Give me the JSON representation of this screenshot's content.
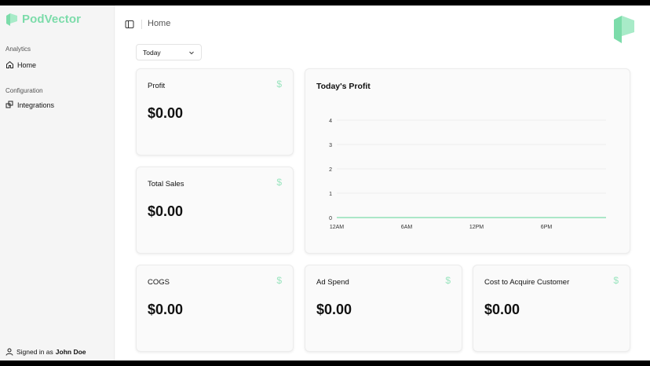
{
  "app": {
    "name": "PodVector",
    "accent": "#7cdcaa"
  },
  "sidebar": {
    "sections": [
      {
        "label": "Analytics",
        "items": [
          {
            "label": "Home",
            "icon": "home-icon"
          }
        ]
      },
      {
        "label": "Configuration",
        "items": [
          {
            "label": "Integrations",
            "icon": "puzzle-icon"
          }
        ]
      }
    ],
    "footer": {
      "prefix": "Signed in as",
      "user": "John Doe"
    }
  },
  "header": {
    "title": "Home"
  },
  "filter": {
    "selected": "Today"
  },
  "cards": {
    "profit": {
      "title": "Profit",
      "value": "$0.00",
      "icon": "$"
    },
    "total_sales": {
      "title": "Total Sales",
      "value": "$0.00",
      "icon": "$"
    },
    "cogs": {
      "title": "COGS",
      "value": "$0.00",
      "icon": "$"
    },
    "ad_spend": {
      "title": "Ad Spend",
      "value": "$0.00",
      "icon": "$"
    },
    "cac": {
      "title": "Cost to Acquire Customer",
      "value": "$0.00",
      "icon": "$"
    }
  },
  "chart_data": {
    "type": "line",
    "title": "Today's Profit",
    "x_tick_labels": [
      "12AM",
      "6AM",
      "12PM",
      "6PM"
    ],
    "y_tick_labels": [
      "0",
      "1",
      "2",
      "3",
      "4"
    ],
    "ylim": [
      0,
      4
    ],
    "grid": true,
    "series": [
      {
        "color": "#7cdcaa",
        "x": [
          "12AM",
          "6AM",
          "12PM",
          "6PM"
        ],
        "values": [
          0,
          0,
          0,
          0
        ]
      }
    ]
  }
}
